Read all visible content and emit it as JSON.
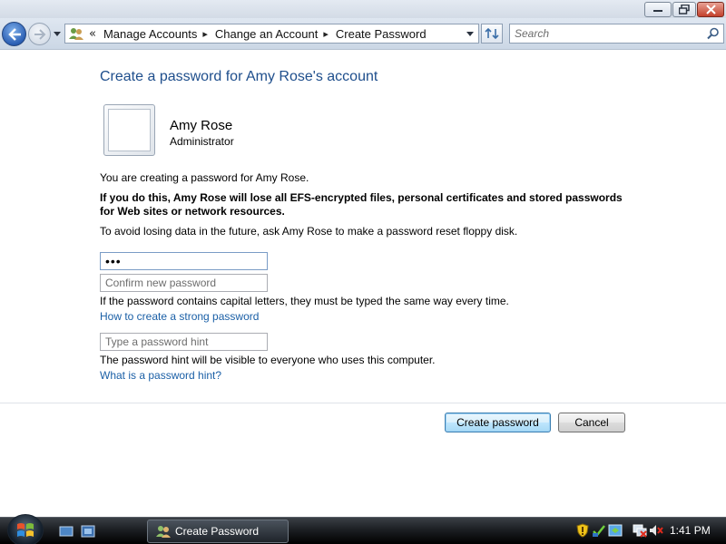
{
  "window": {
    "title_controls": {
      "minimize": "minimize",
      "maximize": "maximize",
      "close": "close"
    }
  },
  "navigation": {
    "back_icon": "back-arrow-icon",
    "forward_icon": "forward-arrow-icon",
    "breadcrumb_overflow": "«",
    "breadcrumbs": [
      "Manage Accounts",
      "Change an Account",
      "Create Password"
    ],
    "search_placeholder": "Search"
  },
  "content": {
    "title": "Create a password for Amy Rose's account",
    "user": {
      "name": "Amy Rose",
      "role": "Administrator"
    },
    "intro": "You are creating a password for Amy Rose.",
    "warning": "If you do this, Amy Rose will lose all EFS-encrypted files, personal certificates and stored passwords for Web sites or network resources.",
    "advice": "To avoid losing data in the future, ask Amy Rose to make a password reset floppy disk.",
    "new_password_value": "•••",
    "confirm_placeholder": "Confirm new password",
    "caps_note": "If the password contains capital letters, they must be typed the same way every time.",
    "strong_password_link": "How to create a strong password",
    "hint_placeholder": "Type a password hint",
    "hint_note": "The password hint will be visible to everyone who uses this computer.",
    "hint_link": "What is a password hint?",
    "create_button": "Create password",
    "cancel_button": "Cancel"
  },
  "taskbar": {
    "active_task": "Create Password",
    "clock": "1:41 PM"
  },
  "colors": {
    "title_blue": "#1e4e8c",
    "link_blue": "#1a5fa6",
    "taskbar_dark": "#1c1f23"
  }
}
